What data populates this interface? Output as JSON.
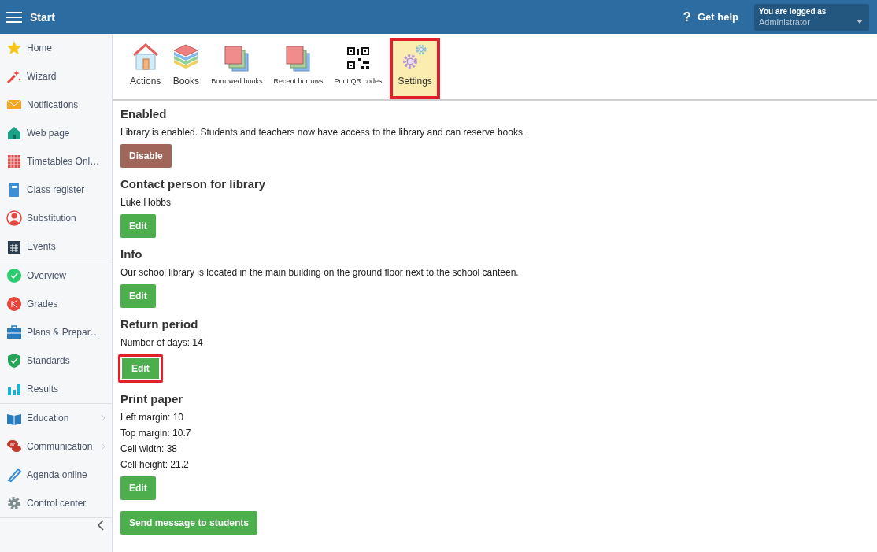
{
  "topbar": {
    "title": "Start",
    "help_icon": "?",
    "help": "Get help",
    "user_label": "You are logged as",
    "user_role": "Administrator"
  },
  "sidebar": {
    "groups": [
      {
        "items": [
          {
            "label": "Home",
            "has_submenu": false
          },
          {
            "label": "Wizard",
            "has_submenu": false
          },
          {
            "label": "Notifications",
            "has_submenu": false
          },
          {
            "label": "Web page",
            "has_submenu": false
          },
          {
            "label": "Timetables Onl…",
            "has_submenu": false
          },
          {
            "label": "Class register",
            "has_submenu": false
          },
          {
            "label": "Substitution",
            "has_submenu": false
          },
          {
            "label": "Events",
            "has_submenu": false
          }
        ]
      },
      {
        "items": [
          {
            "label": "Overview",
            "has_submenu": false
          },
          {
            "label": "Grades",
            "has_submenu": false
          },
          {
            "label": "Plans & Prepar…",
            "has_submenu": false
          },
          {
            "label": "Standards",
            "has_submenu": false
          },
          {
            "label": "Results",
            "has_submenu": false
          }
        ]
      },
      {
        "items": [
          {
            "label": "Education",
            "has_submenu": true
          },
          {
            "label": "Communication",
            "has_submenu": true
          },
          {
            "label": "Agenda online",
            "has_submenu": false
          },
          {
            "label": "Control center",
            "has_submenu": false
          }
        ]
      }
    ]
  },
  "toolbar": [
    {
      "label": "Actions",
      "kind": "large",
      "selected": false,
      "highlighted": false
    },
    {
      "label": "Books",
      "kind": "large",
      "selected": false,
      "highlighted": false
    },
    {
      "label": "Borrowed books",
      "kind": "small",
      "selected": false,
      "highlighted": false
    },
    {
      "label": "Recent borrows",
      "kind": "small",
      "selected": false,
      "highlighted": false
    },
    {
      "label": "Print QR codes",
      "kind": "small",
      "selected": false,
      "highlighted": false
    },
    {
      "label": "Settings",
      "kind": "large",
      "selected": true,
      "highlighted": true
    }
  ],
  "sections": [
    {
      "title": "Enabled",
      "lines": [
        "Library is enabled. Students and teachers now have access to the library and can reserve books."
      ],
      "button": {
        "label": "Disable",
        "kind": "danger",
        "highlighted": false
      }
    },
    {
      "title": "Contact person for library",
      "lines": [
        "Luke Hobbs"
      ],
      "button": {
        "label": "Edit",
        "kind": "primary",
        "highlighted": false
      }
    },
    {
      "title": "Info",
      "lines": [
        "Our school library is located in the main building on the ground floor next to the school canteen."
      ],
      "button": {
        "label": "Edit",
        "kind": "primary",
        "highlighted": false
      }
    },
    {
      "title": "Return period",
      "lines": [
        "Number of days: 14"
      ],
      "button": {
        "label": "Edit",
        "kind": "primary",
        "highlighted": true
      }
    },
    {
      "title": "Print paper",
      "lines": [
        "Left margin: 10",
        "Top margin: 10.7",
        "Cell width: 38",
        "Cell height: 21.2"
      ],
      "button": {
        "label": "Edit",
        "kind": "primary",
        "highlighted": false
      }
    }
  ],
  "footer_button": {
    "label": "Send message to students",
    "kind": "primary",
    "highlighted": false
  }
}
